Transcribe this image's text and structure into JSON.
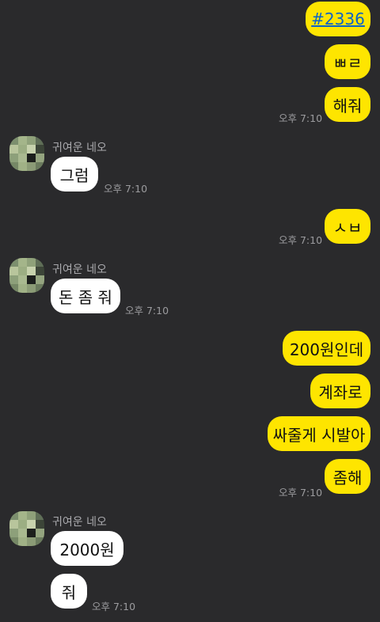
{
  "contact_name": "귀여운 네오",
  "messages_me_1": [
    "#2336",
    "ㅃㄹ",
    "해줘"
  ],
  "time_me_1": "오후 7:10",
  "them_1_text": "그럼",
  "time_them_1": "오후 7:10",
  "me_2_text": "ㅅㅂ",
  "time_me_2": "오후 7:10",
  "them_2_text": "돈 좀 줘",
  "time_them_2": "오후 7:10",
  "messages_me_3": [
    "200원인데",
    "계좌로",
    "싸줄게 시발아",
    "좀해"
  ],
  "time_me_3": "오후 7:10",
  "them_3_texts": [
    "2000원",
    "줘"
  ],
  "time_them_3": "오후 7:10",
  "colors": {
    "my_bubble": "#fee500",
    "their_bubble": "#ffffff",
    "background": "#2a2a2c",
    "link": "#0b63c9"
  },
  "icons": {
    "avatar": "pixelated-profile-avatar"
  }
}
